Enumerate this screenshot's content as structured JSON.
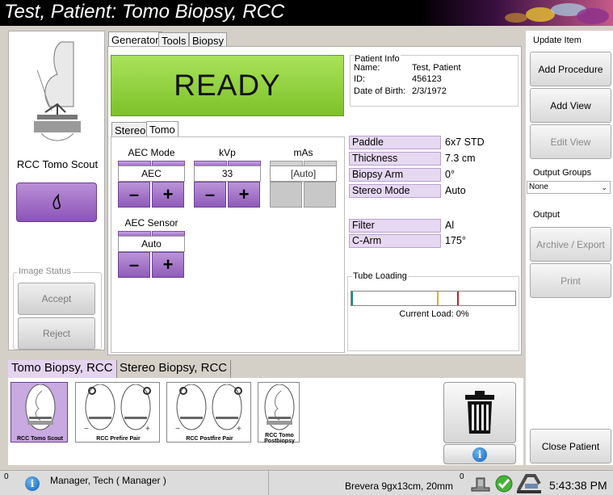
{
  "title": "Test, Patient:  Tomo Biopsy, RCC",
  "left_panel": {
    "view_label": "RCC Tomo Scout",
    "image_status_label": "Image Status",
    "accept_label": "Accept",
    "reject_label": "Reject"
  },
  "top_tabs": [
    "Generator",
    "Tools",
    "Biopsy"
  ],
  "ready_text": "READY",
  "patient_info": {
    "header": "Patient Info",
    "name_label": "Name:",
    "name": "Test, Patient",
    "id_label": "ID:",
    "id": "456123",
    "dob_label": "Date of Birth:",
    "dob": "2/3/1972"
  },
  "sub_tabs": [
    "Stereo",
    "Tomo"
  ],
  "controls": {
    "aec_mode_label": "AEC Mode",
    "aec_mode_value": "AEC",
    "kvp_label": "kVp",
    "kvp_value": "33",
    "mas_label": "mAs",
    "mas_value": "[Auto]",
    "aec_sensor_label": "AEC Sensor",
    "aec_sensor_value": "Auto",
    "minus": "–",
    "plus": "+"
  },
  "params": [
    {
      "label": "Paddle",
      "value": "6x7 STD"
    },
    {
      "label": "Thickness",
      "value": "7.3 cm"
    },
    {
      "label": "Biopsy Arm",
      "value": "0°"
    },
    {
      "label": "Stereo Mode",
      "value": "Auto"
    },
    {
      "label": "Filter",
      "value": "Al"
    },
    {
      "label": "C-Arm",
      "value": "175°"
    }
  ],
  "tube_loading": {
    "header": "Tube Loading",
    "current_load_text": "Current Load: 0%",
    "current_load": 0
  },
  "right_bar": {
    "update_item": "Update Item",
    "add_procedure": "Add Procedure",
    "add_view": "Add View",
    "edit_view": "Edit View",
    "output_groups": "Output Groups",
    "output_groups_value": "None",
    "output": "Output",
    "archive_export": "Archive / Export",
    "print": "Print",
    "close_patient": "Close Patient"
  },
  "bottom_tabs": [
    "Tomo Biopsy, RCC",
    "Stereo Biopsy, RCC"
  ],
  "thumbnails": [
    {
      "label": "RCC Tomo Scout",
      "selected": true
    },
    {
      "label": "RCC Prefire Pair",
      "selected": false
    },
    {
      "label": "RCC Postfire Pair",
      "selected": false
    },
    {
      "label": "RCC Tomo Postbiopsy",
      "selected": false
    }
  ],
  "status_bar": {
    "left_count": "0",
    "user": "Manager, Tech ( Manager )",
    "paddle_info": "Brevera 9gx13cm, 20mm",
    "right_count": "0",
    "time": "5:43:38 PM"
  },
  "colors": {
    "ready_green": "#8fd13a",
    "purple_button": "#9b65c5",
    "param_bg": "#e7d8f2"
  }
}
